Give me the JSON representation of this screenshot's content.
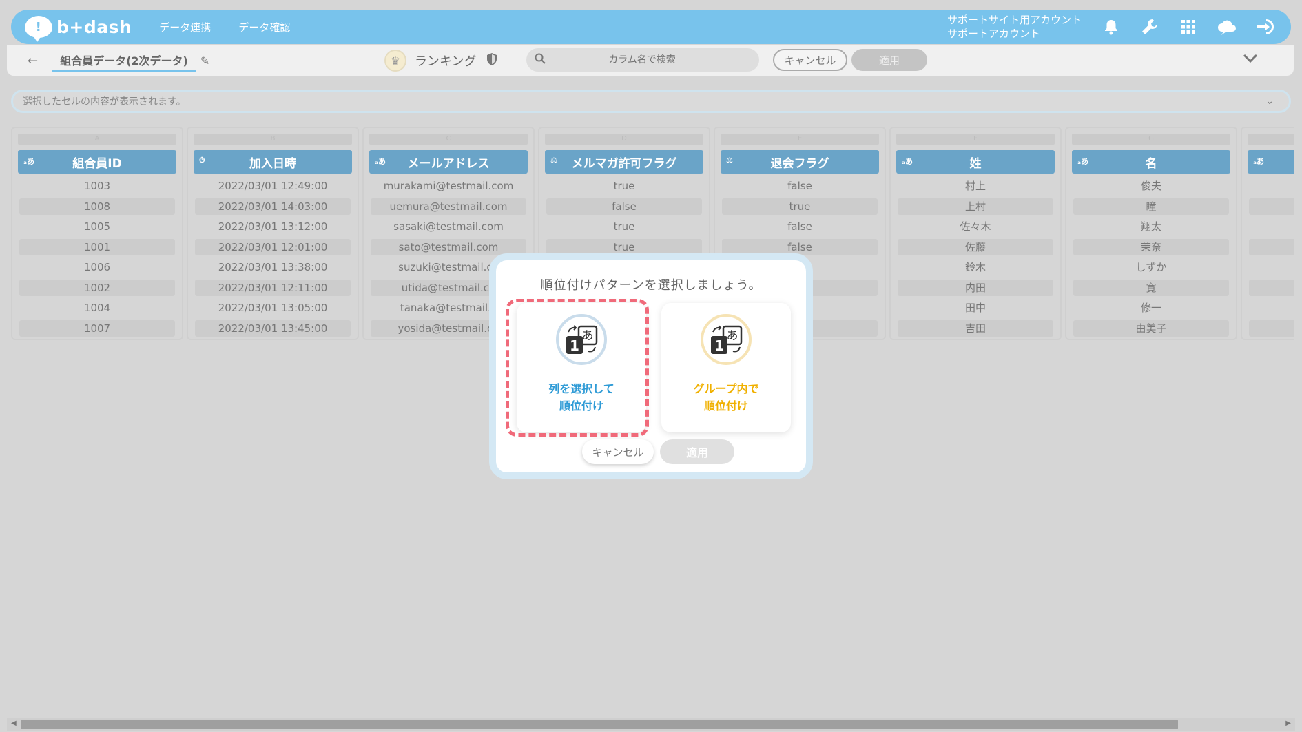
{
  "header": {
    "logo_text": "b+dash",
    "nav": [
      "データ連携",
      "データ確認"
    ],
    "account_line1": "サポートサイト用アカウント",
    "account_line2": "サポートアカウント",
    "icons": [
      "bell-icon",
      "wrench-icon",
      "grid-menu-icon",
      "cloud-badge-icon",
      "logout-icon"
    ],
    "brand_color": "#78c3ec"
  },
  "toolbar": {
    "dataset_title": "組合員データ(2次データ)",
    "operation": "ランキング",
    "search_placeholder": "カラム名で検索",
    "cancel_label": "キャンセル",
    "apply_label": "適用"
  },
  "cell_preview": {
    "text": "選択したセルの内容が表示されます。"
  },
  "grid": {
    "columns": [
      {
        "letter": "A",
        "type": "text",
        "name": "組合員ID",
        "cells": [
          "1003",
          "1008",
          "1005",
          "1001",
          "1006",
          "1002",
          "1004",
          "1007"
        ]
      },
      {
        "letter": "B",
        "type": "datetime",
        "name": "加入日時",
        "cells": [
          "2022/03/01 12:49:00",
          "2022/03/01 14:03:00",
          "2022/03/01 13:12:00",
          "2022/03/01 12:01:00",
          "2022/03/01 13:38:00",
          "2022/03/01 12:11:00",
          "2022/03/01 13:05:00",
          "2022/03/01 13:45:00"
        ]
      },
      {
        "letter": "C",
        "type": "text",
        "name": "メールアドレス",
        "cells": [
          "murakami@testmail.com",
          "uemura@testmail.com",
          "sasaki@testmail.com",
          "sato@testmail.com",
          "suzuki@testmail.co",
          "utida@testmail.co",
          "tanaka@testmail.c",
          "yosida@testmail.co"
        ]
      },
      {
        "letter": "D",
        "type": "boolean",
        "name": "メルマガ許可フラグ",
        "cells": [
          "true",
          "false",
          "true",
          "true",
          "",
          "",
          "",
          ""
        ]
      },
      {
        "letter": "E",
        "type": "boolean",
        "name": "退会フラグ",
        "cells": [
          "false",
          "true",
          "false",
          "false",
          "",
          "",
          "",
          ""
        ]
      },
      {
        "letter": "F",
        "type": "text",
        "name": "姓",
        "cells": [
          "村上",
          "上村",
          "佐々木",
          "佐藤",
          "鈴木",
          "内田",
          "田中",
          "吉田"
        ]
      },
      {
        "letter": "G",
        "type": "text",
        "name": "名",
        "cells": [
          "俊夫",
          "瞳",
          "翔太",
          "茉奈",
          "しずか",
          "寛",
          "修一",
          "由美子"
        ]
      },
      {
        "letter": "H",
        "type": "text",
        "name": "",
        "cells": [
          "",
          "",
          "",
          "",
          "",
          "",
          "",
          ""
        ]
      }
    ]
  },
  "modal": {
    "title": "順位付けパターンを選択しましょう。",
    "option_left_line1": "列を選択して",
    "option_left_line2": "順位付け",
    "option_right_line1": "グループ内で",
    "option_right_line2": "順位付け",
    "cancel_label": "キャンセル",
    "apply_label": "適用",
    "highlight_color": "#f06a7a"
  }
}
